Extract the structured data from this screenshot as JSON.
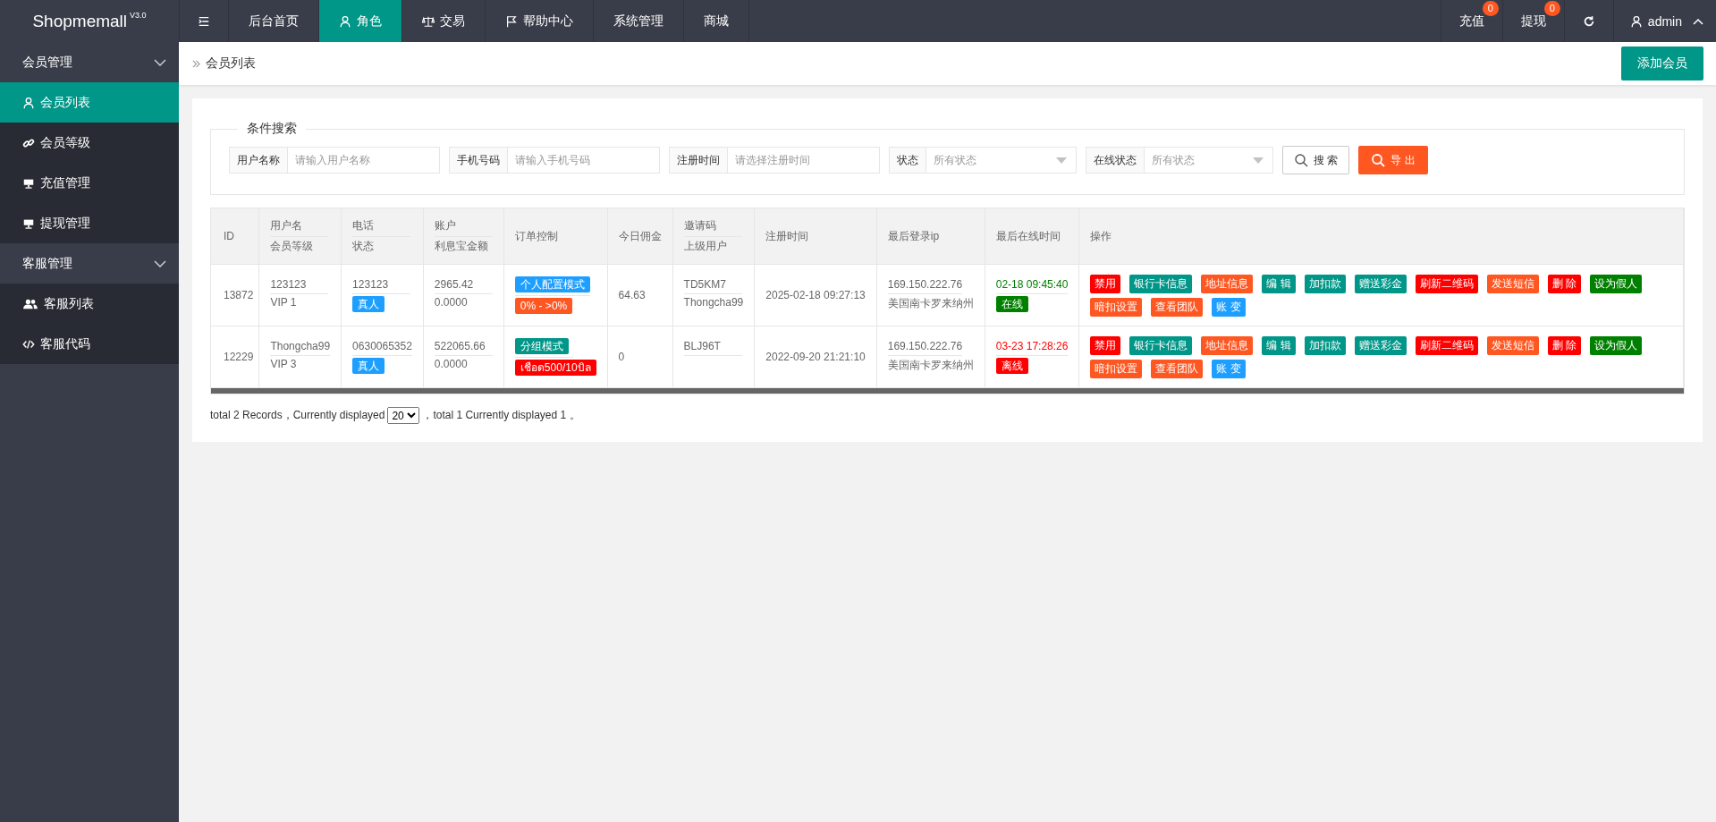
{
  "brand": {
    "name": "Shopmemall",
    "version": "V3.0"
  },
  "top_nav": [
    {
      "label": "后台首页",
      "selected": false
    },
    {
      "label": "角色",
      "selected": true
    },
    {
      "label": "交易",
      "selected": false
    },
    {
      "label": "帮助中心",
      "selected": false
    },
    {
      "label": "系统管理",
      "selected": false
    },
    {
      "label": "商城",
      "selected": false
    }
  ],
  "top_right": [
    {
      "label": "充值",
      "badge": "0"
    },
    {
      "label": "提现",
      "badge": "0"
    }
  ],
  "user": {
    "name": "admin"
  },
  "sidebar": [
    {
      "label": "会员管理",
      "expanded": true,
      "children": [
        {
          "label": "会员列表",
          "selected": true
        },
        {
          "label": "会员等级",
          "selected": false
        },
        {
          "label": "充值管理",
          "selected": false
        },
        {
          "label": "提现管理",
          "selected": false
        }
      ]
    },
    {
      "label": "客服管理",
      "expanded": true,
      "children": [
        {
          "label": "客服列表",
          "selected": false
        },
        {
          "label": "客服代码",
          "selected": false
        }
      ]
    }
  ],
  "breadcrumb": "会员列表",
  "add_button": "添加会员",
  "search": {
    "legend": "条件搜索",
    "fields": [
      {
        "kind": "input",
        "label": "用户名称",
        "placeholder": "请输入用户名称"
      },
      {
        "kind": "input",
        "label": "手机号码",
        "placeholder": "请输入手机号码"
      },
      {
        "kind": "input",
        "label": "注册时间",
        "placeholder": "请选择注册时间"
      },
      {
        "kind": "select",
        "label": "状态",
        "value": "所有状态"
      },
      {
        "kind": "select",
        "label": "在线状态",
        "value": "所有状态"
      }
    ],
    "search_button": "搜 索",
    "export_button": "导 出"
  },
  "table": {
    "columns": [
      {
        "label": "ID"
      },
      {
        "label": "用户名",
        "sublabel": "会员等级"
      },
      {
        "label": "电话",
        "sublabel": "状态"
      },
      {
        "label": "账户",
        "sublabel": "利息宝金额"
      },
      {
        "label": "订单控制"
      },
      {
        "label": "今日佣金"
      },
      {
        "label": "邀请码",
        "sublabel": "上级用户"
      },
      {
        "label": "注册时间"
      },
      {
        "label": "最后登录ip"
      },
      {
        "label": "最后在线时间"
      },
      {
        "label": "操作"
      }
    ],
    "rows": [
      {
        "id": "13872",
        "username": "123123",
        "level": "VIP 1",
        "phone": "123123",
        "status": "真人",
        "account": "2965.42",
        "interest": "0.0000",
        "mode": {
          "label": "个人配置模式",
          "color": "#1e9fff"
        },
        "ratio": {
          "label": "0% - >0%",
          "color": "#ff5722"
        },
        "commission": "64.63",
        "invite_code": "TD5KM7",
        "parent": "Thongcha99",
        "registered": "2025-02-18 09:27:13",
        "ip": "169.150.222.76",
        "location": "美国南卡罗来纳州",
        "last_online": "02-18 09:45:40",
        "online": true,
        "online_label": "在线",
        "actions": [
          {
            "label": "禁用",
            "color": "#ff0000"
          },
          {
            "label": "银行卡信息",
            "color": "#009688"
          },
          {
            "label": "地址信息",
            "color": "#ff5722"
          },
          {
            "label": "编 辑",
            "color": "#009688"
          },
          {
            "label": "加扣款",
            "color": "#009688"
          },
          {
            "label": "赠送彩金",
            "color": "#009688"
          },
          {
            "label": "刷新二维码",
            "color": "#ff0000"
          },
          {
            "label": "发送短信",
            "color": "#ff5722"
          },
          {
            "label": "删 除",
            "color": "#ff0000"
          },
          {
            "label": "设为假人",
            "color": "#008000"
          },
          {
            "label": "暗扣设置",
            "color": "#ff5722"
          },
          {
            "label": "查看团队",
            "color": "#ff5722"
          },
          {
            "label": "账 变",
            "color": "#1e9fff"
          }
        ]
      },
      {
        "id": "12229",
        "username": "Thongcha99",
        "level": "VIP 3",
        "phone": "0630065352",
        "status": "真人",
        "account": "522065.66",
        "interest": "0.0000",
        "mode": {
          "label": "分组模式",
          "color": "#009688"
        },
        "ratio": {
          "label": "เชือด500/10บิล",
          "color": "#ff0000"
        },
        "commission": "0",
        "invite_code": "BLJ96T",
        "registered": "2022-09-20 21:21:10",
        "ip": "169.150.222.76",
        "location": "美国南卡罗来纳州",
        "last_online": "03-23 17:28:26",
        "online": false,
        "online_label": "离线",
        "actions": [
          {
            "label": "禁用",
            "color": "#ff0000"
          },
          {
            "label": "银行卡信息",
            "color": "#009688"
          },
          {
            "label": "地址信息",
            "color": "#ff5722"
          },
          {
            "label": "编 辑",
            "color": "#009688"
          },
          {
            "label": "加扣款",
            "color": "#009688"
          },
          {
            "label": "赠送彩金",
            "color": "#009688"
          },
          {
            "label": "刷新二维码",
            "color": "#ff0000"
          },
          {
            "label": "发送短信",
            "color": "#ff5722"
          },
          {
            "label": "删 除",
            "color": "#ff0000"
          },
          {
            "label": "设为假人",
            "color": "#008000"
          },
          {
            "label": "暗扣设置",
            "color": "#ff5722"
          },
          {
            "label": "查看团队",
            "color": "#ff5722"
          },
          {
            "label": "账 变",
            "color": "#1e9fff"
          }
        ]
      }
    ]
  },
  "pager": {
    "before": "total 2 Records，Currently displayed",
    "page_size": "20",
    "after": "，total 1 Currently displayed 1 。"
  }
}
